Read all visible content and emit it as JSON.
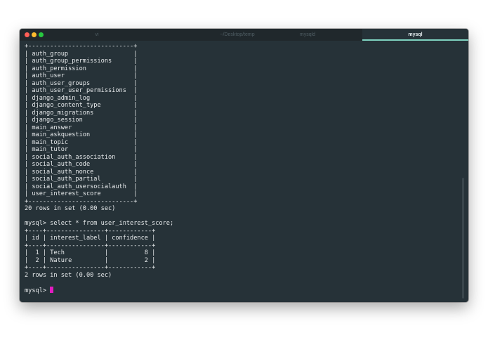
{
  "tabs": [
    {
      "label": "vi"
    },
    {
      "label": "~/Desktop/temp"
    },
    {
      "label": "mysqld"
    },
    {
      "label": "mysql"
    }
  ],
  "terminal": {
    "lines": [
      "+-----------------------------+",
      "| auth_group                  |",
      "| auth_group_permissions      |",
      "| auth_permission             |",
      "| auth_user                   |",
      "| auth_user_groups            |",
      "| auth_user_user_permissions  |",
      "| django_admin_log            |",
      "| django_content_type         |",
      "| django_migrations           |",
      "| django_session              |",
      "| main_answer                 |",
      "| main_askquestion            |",
      "| main_topic                  |",
      "| main_tutor                  |",
      "| social_auth_association     |",
      "| social_auth_code            |",
      "| social_auth_nonce           |",
      "| social_auth_partial         |",
      "| social_auth_usersocialauth  |",
      "| user_interest_score         |",
      "+-----------------------------+",
      "20 rows in set (0.00 sec)",
      "",
      "mysql> select * from user_interest_score;",
      "+----+----------------+------------+",
      "| id | interest_label | confidence |",
      "+----+----------------+------------+",
      "|  1 | Tech           |          8 |",
      "|  2 | Nature         |          2 |",
      "+----+----------------+------------+",
      "2 rows in set (0.00 sec)",
      "",
      "mysql> "
    ]
  },
  "colors": {
    "background": "#263238",
    "text": "#e7eaec",
    "active_tab_indicator": "#7fd3c0",
    "cursor": "#e21cc0"
  }
}
